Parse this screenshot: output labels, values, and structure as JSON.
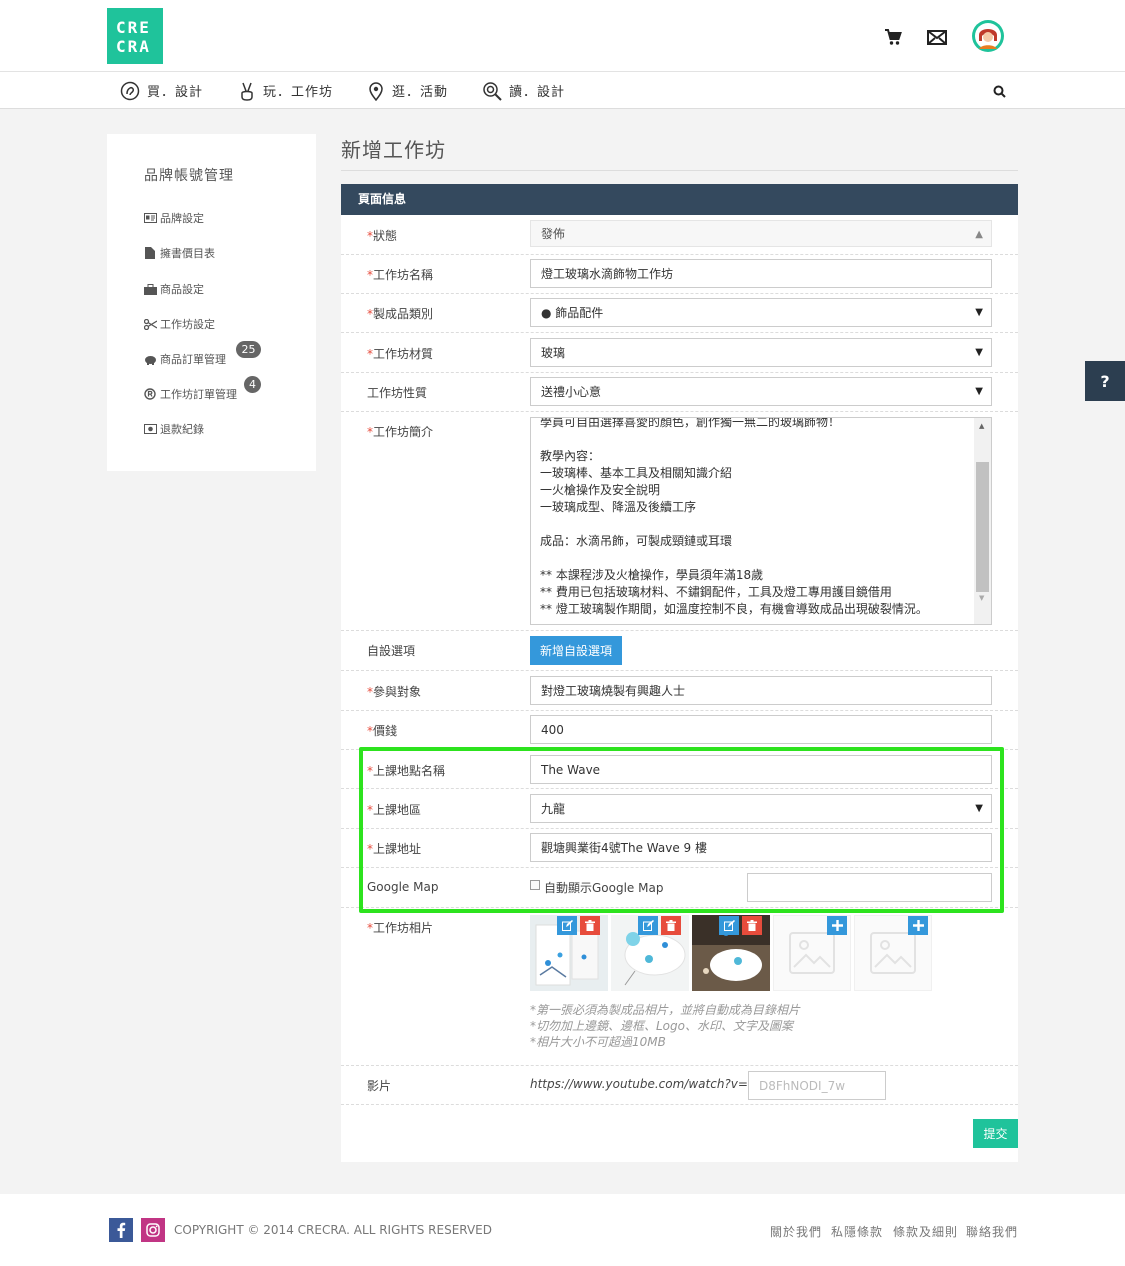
{
  "brand": {
    "logo_line1": "CRE",
    "logo_line2": "CRA",
    "accent": "#1fc39b"
  },
  "header_icons": [
    "cart-icon",
    "mail-icon",
    "user-avatar"
  ],
  "nav": {
    "items": [
      {
        "label": "買．設計",
        "icon": "ear-icon"
      },
      {
        "label": "玩．工作坊",
        "icon": "peace-hand-icon"
      },
      {
        "label": "逛．活動",
        "icon": "location-icon"
      },
      {
        "label": "讀．設計",
        "icon": "magnify-icon"
      }
    ],
    "search_icon": "search-icon"
  },
  "sidebar": {
    "title": "品牌帳號管理",
    "items": [
      {
        "label": "品牌設定",
        "icon": "id-card-icon"
      },
      {
        "label": "擁書價目表",
        "icon": "file-icon"
      },
      {
        "label": "商品設定",
        "icon": "briefcase-icon"
      },
      {
        "label": "工作坊設定",
        "icon": "scissors-icon"
      },
      {
        "label": "商品訂單管理",
        "icon": "piggy-bank-icon",
        "badge": "25"
      },
      {
        "label": "工作坊訂單管理",
        "icon": "registered-icon",
        "badge": "4"
      },
      {
        "label": "退款紀錄",
        "icon": "money-icon"
      }
    ]
  },
  "page": {
    "title": "新增工作坊"
  },
  "form": {
    "header": "頁面信息",
    "status": {
      "label": "狀態",
      "value": "發佈"
    },
    "name": {
      "label": "工作坊名稱",
      "value": "燈工玻璃水滴飾物工作坊"
    },
    "category": {
      "label": "製成品類別",
      "value": "● 飾品配件"
    },
    "material": {
      "label": "工作坊材質",
      "value": "玻璃"
    },
    "nature": {
      "label": "工作坊性質",
      "value": "送禮小心意"
    },
    "intro": {
      "label": "工作坊簡介",
      "value": "學員可自由選擇喜愛的顏色，創作獨一無二的玻璃飾物！\n\n教學內容：\n一玻璃棒、基本工具及相關知識介紹\n一火槍操作及安全說明\n一玻璃成型、降溫及後續工序\n\n成品：水滴吊飾，可製成頸鏈或耳環\n\n** 本課程涉及火槍操作，學員須年滿18歲\n** 費用已包括玻璃材料、不鏽鋼配件，工具及燈工專用護目鏡借用\n** 燈工玻璃製作期間，如溫度控制不良，有機會導致成品出現破裂情況。"
    },
    "custom": {
      "label": "自設選項",
      "button": "新增自設選項"
    },
    "audience": {
      "label": "參與對象",
      "value": "對燈工玻璃燒製有興趣人士"
    },
    "price": {
      "label": "價錢",
      "value": "400"
    },
    "venue_name": {
      "label": "上課地點名稱",
      "value": "The Wave"
    },
    "district": {
      "label": "上課地區",
      "value": "九龍"
    },
    "address": {
      "label": "上課地址",
      "value": "觀塘興業街4號The Wave 9 樓"
    },
    "google_map": {
      "label": "Google Map",
      "checkbox_label": "自動顯示Google Map",
      "value": ""
    },
    "photos": {
      "label": "工作坊相片",
      "notes": [
        "*第一張必須為製成品相片，並將自動成為目錄相片",
        "*切勿加上邊鏡、邊框、Logo、水印、文字及圖案",
        "*相片大小不可超過10MB"
      ]
    },
    "video": {
      "label": "影片",
      "prefix": "https://www.youtube.com/watch?v=",
      "placeholder": "D8FhNODI_7w"
    },
    "submit": "提交",
    "required_mark": "*"
  },
  "help_tab": "?",
  "highlight_color": "#2de31e",
  "footer": {
    "copyright": "COPYRIGHT © 2014 CRECRA. ALL RIGHTS RESERVED",
    "links": [
      "關於我們",
      "私隱條款",
      "條款及細則",
      "聯絡我們"
    ],
    "social": [
      "facebook-icon",
      "instagram-icon"
    ]
  }
}
